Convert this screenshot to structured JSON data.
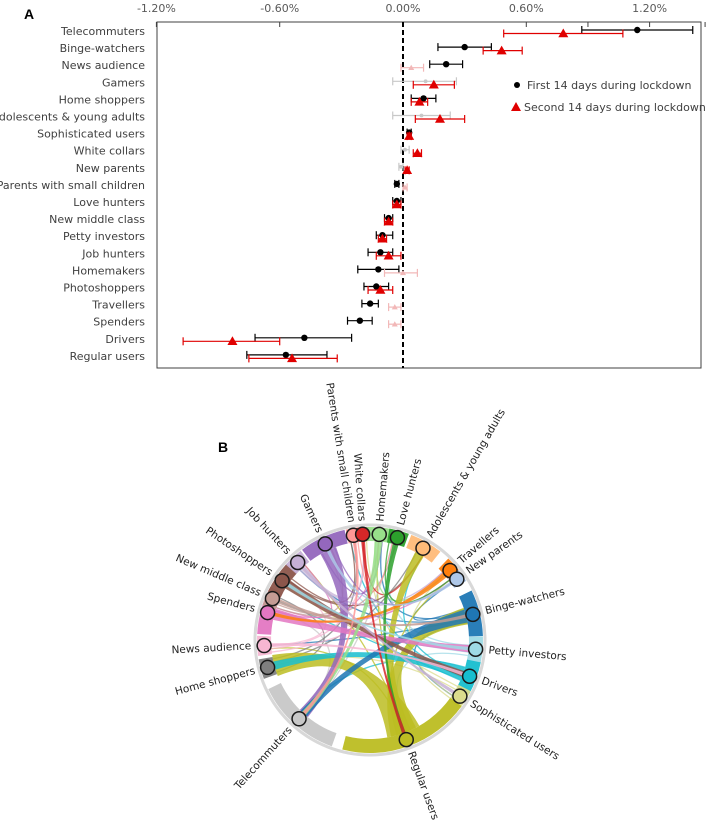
{
  "figure": {
    "panel_a_label": "A",
    "panel_b_label": "B"
  },
  "chart_data": [
    {
      "type": "scatter",
      "subtype": "dot-with-error-bars",
      "panel": "A",
      "title": "",
      "xlabel": "",
      "ylabel": "",
      "x_tick_labels": [
        "-1.20%",
        "-0.60%",
        "0.00%",
        "0.60%",
        "1.20%"
      ],
      "x_ticks": [
        -1.2,
        -0.6,
        0.0,
        0.6,
        1.2
      ],
      "xlim": [
        -1.2,
        1.5
      ],
      "x_axis_position": "top",
      "reference_line": {
        "x": 0.0,
        "style": "dashed"
      },
      "grid": false,
      "legend": {
        "placement": "right",
        "entries": [
          {
            "label": "First 14 days during lockdown",
            "marker": "circle",
            "color": "#000000"
          },
          {
            "label": "Second 14 days during lockdown",
            "marker": "triangle",
            "color": "#e00000"
          }
        ]
      },
      "categories": [
        "Telecommuters",
        "Binge-watchers",
        "News audience",
        "Gamers",
        "Home shoppers",
        "Adolescents & young adults",
        "Sophisticated users",
        "White collars",
        "New parents",
        "Parents with small children",
        "Love hunters",
        "New middle class",
        "Petty investors",
        "Job hunters",
        "Homemakers",
        "Photoshoppers",
        "Travellers",
        "Spenders",
        "Drivers",
        "Regular users"
      ],
      "series": [
        {
          "name": "First 14 days during lockdown",
          "marker": "circle",
          "color": "#000000",
          "faded_color": "#c8c8c8",
          "values": [
            1.14,
            0.3,
            0.21,
            0.11,
            0.1,
            0.09,
            0.03,
            0.01,
            -0.01,
            -0.03,
            -0.03,
            -0.07,
            -0.1,
            -0.11,
            -0.12,
            -0.13,
            -0.16,
            -0.21,
            -0.48,
            -0.57
          ],
          "ci_low": [
            0.87,
            0.17,
            0.13,
            -0.05,
            0.04,
            -0.05,
            0.02,
            -0.01,
            -0.02,
            -0.04,
            -0.05,
            -0.09,
            -0.13,
            -0.17,
            -0.22,
            -0.19,
            -0.2,
            -0.27,
            -0.72,
            -0.76
          ],
          "ci_high": [
            1.41,
            0.43,
            0.29,
            0.26,
            0.16,
            0.23,
            0.04,
            0.03,
            0.0,
            -0.02,
            -0.01,
            -0.05,
            -0.05,
            -0.05,
            -0.02,
            -0.07,
            -0.12,
            -0.15,
            -0.25,
            -0.37
          ],
          "significant": [
            true,
            true,
            true,
            false,
            true,
            false,
            true,
            false,
            false,
            true,
            true,
            true,
            true,
            true,
            true,
            true,
            true,
            true,
            true,
            true
          ]
        },
        {
          "name": "Second 14 days during lockdown",
          "marker": "triangle",
          "color": "#e00000",
          "faded_color": "#f2b8b8",
          "values": [
            0.78,
            0.48,
            0.04,
            0.15,
            0.08,
            0.18,
            0.03,
            0.07,
            0.02,
            0.01,
            -0.03,
            -0.07,
            -0.1,
            -0.07,
            0.0,
            -0.11,
            -0.04,
            -0.04,
            -0.83,
            -0.54
          ],
          "ci_low": [
            0.49,
            0.39,
            -0.01,
            0.05,
            0.04,
            0.06,
            0.02,
            0.05,
            0.01,
            0.0,
            -0.05,
            -0.09,
            -0.12,
            -0.13,
            -0.09,
            -0.17,
            -0.07,
            -0.07,
            -1.07,
            -0.75
          ],
          "ci_high": [
            1.07,
            0.58,
            0.1,
            0.25,
            0.12,
            0.3,
            0.04,
            0.09,
            0.03,
            0.02,
            -0.01,
            -0.05,
            -0.08,
            -0.01,
            0.07,
            -0.05,
            -0.01,
            -0.01,
            -0.6,
            -0.32
          ],
          "significant": [
            true,
            true,
            false,
            true,
            true,
            true,
            true,
            true,
            true,
            false,
            true,
            true,
            true,
            true,
            false,
            true,
            false,
            false,
            true,
            true
          ]
        }
      ]
    },
    {
      "type": "chord",
      "panel": "B",
      "title": "",
      "nodes": [
        {
          "label": "Binge-watchers",
          "color": "#1f77b4",
          "angle_deg": 14,
          "share": 0.07
        },
        {
          "label": "Petty investors",
          "color": "#9edae5",
          "angle_deg": -5,
          "share": 0.04
        },
        {
          "label": "Drivers",
          "color": "#17becf",
          "angle_deg": -20,
          "share": 0.05
        },
        {
          "label": "Sophisticated users",
          "color": "#dbdb8d",
          "angle_deg": -32,
          "share": 0.03
        },
        {
          "label": "Regular users",
          "color": "#bcbd22",
          "angle_deg": -70,
          "share": 0.2
        },
        {
          "label": "Telecommuters",
          "color": "#c7c7c7",
          "angle_deg": -132,
          "share": 0.13
        },
        {
          "label": "Home shoppers",
          "color": "#7f7f7f",
          "angle_deg": -165,
          "share": 0.03
        },
        {
          "label": "News audience",
          "color": "#f7b6d2",
          "angle_deg": -177,
          "share": 0.03
        },
        {
          "label": "Spenders",
          "color": "#e377c2",
          "angle_deg": 165,
          "share": 0.07
        },
        {
          "label": "New middle class",
          "color": "#c49c94",
          "angle_deg": 157,
          "share": 0.03
        },
        {
          "label": "Photoshoppers",
          "color": "#8c564b",
          "angle_deg": 146,
          "share": 0.05
        },
        {
          "label": "Job hunters",
          "color": "#c5b0d5",
          "angle_deg": 133,
          "share": 0.03
        },
        {
          "label": "Gamers",
          "color": "#9467bd",
          "angle_deg": 115,
          "share": 0.07
        },
        {
          "label": "Parents with small children",
          "color": "#ff9896",
          "angle_deg": 99,
          "share": 0.02
        },
        {
          "label": "White collars",
          "color": "#d62728",
          "angle_deg": 94,
          "share": 0.02
        },
        {
          "label": "Homemakers",
          "color": "#98df8a",
          "angle_deg": 85,
          "share": 0.04
        },
        {
          "label": "Love hunters",
          "color": "#2ca02c",
          "angle_deg": 75,
          "share": 0.03
        },
        {
          "label": "Adolescents & young adults",
          "color": "#ffbb78",
          "angle_deg": 60,
          "share": 0.05
        },
        {
          "label": "Travellers",
          "color": "#ff7f0e",
          "angle_deg": 41,
          "share": 0.03
        },
        {
          "label": "New parents",
          "color": "#aec7e8",
          "angle_deg": 35,
          "share": 0.02
        }
      ],
      "major_links": [
        {
          "source": "Regular users",
          "target": "Home shoppers",
          "weight": 0.9
        },
        {
          "source": "Regular users",
          "target": "Binge-watchers",
          "weight": 0.7
        },
        {
          "source": "Regular users",
          "target": "Adolescents & young adults",
          "weight": 0.4
        },
        {
          "source": "Drivers",
          "target": "Home shoppers",
          "weight": 0.35
        },
        {
          "source": "Gamers",
          "target": "Telecommuters",
          "weight": 0.45
        },
        {
          "source": "Binge-watchers",
          "target": "Telecommuters",
          "weight": 0.35
        },
        {
          "source": "Spenders",
          "target": "Petty investors",
          "weight": 0.3
        },
        {
          "source": "Photoshoppers",
          "target": "Drivers",
          "weight": 0.25
        },
        {
          "source": "Homemakers",
          "target": "Telecommuters",
          "weight": 0.2
        },
        {
          "source": "Travellers",
          "target": "Spenders",
          "weight": 0.15
        },
        {
          "source": "Love hunters",
          "target": "Regular users",
          "weight": 0.15
        },
        {
          "source": "Job hunters",
          "target": "Sophisticated users",
          "weight": 0.12
        },
        {
          "source": "New middle class",
          "target": "Binge-watchers",
          "weight": 0.12
        },
        {
          "source": "White collars",
          "target": "Regular users",
          "weight": 0.1
        },
        {
          "source": "News audience",
          "target": "Drivers",
          "weight": 0.1
        },
        {
          "source": "Parents with small children",
          "target": "Telecommuters",
          "weight": 0.08
        },
        {
          "source": "New parents",
          "target": "Gamers",
          "weight": 0.08
        },
        {
          "source": "Petty investors",
          "target": "Photoshoppers",
          "weight": 0.08
        }
      ]
    }
  ]
}
